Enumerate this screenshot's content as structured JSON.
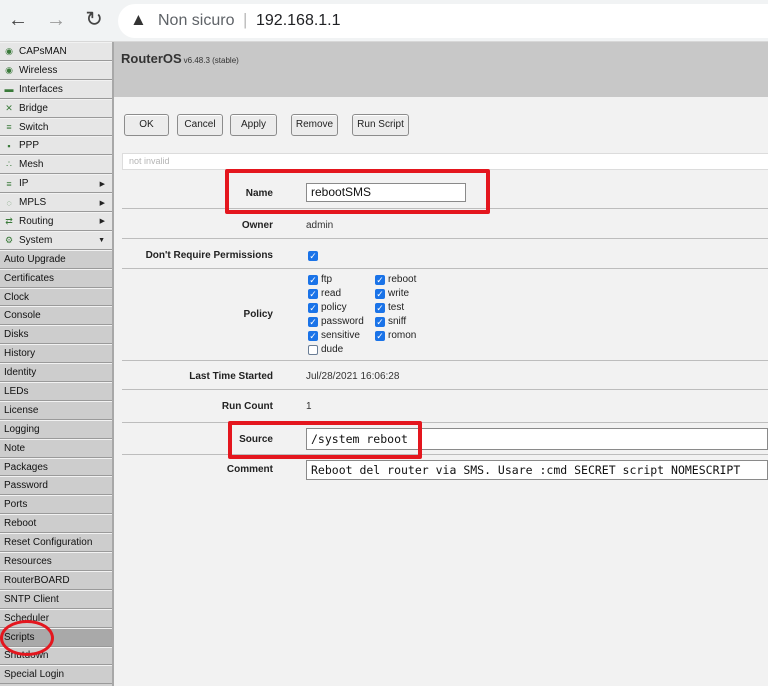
{
  "browser": {
    "back_glyph": "←",
    "forward_glyph": "→",
    "reload_glyph": "↻",
    "warning_glyph": "▲",
    "security_text": "Non sicuro",
    "separator": "|",
    "url": "192.168.1.1"
  },
  "sidebar": {
    "top_items": [
      {
        "label": "CAPsMAN",
        "icon": "capsman-icon",
        "glyph": "◉"
      },
      {
        "label": "Wireless",
        "icon": "wireless-icon",
        "glyph": "◉"
      },
      {
        "label": "Interfaces",
        "icon": "interfaces-icon",
        "glyph": "▬"
      },
      {
        "label": "Bridge",
        "icon": "bridge-icon",
        "glyph": "✕"
      },
      {
        "label": "Switch",
        "icon": "switch-icon",
        "glyph": "≡"
      },
      {
        "label": "PPP",
        "icon": "ppp-icon",
        "glyph": "▪"
      },
      {
        "label": "Mesh",
        "icon": "mesh-icon",
        "glyph": "∴"
      },
      {
        "label": "IP",
        "icon": "ip-icon",
        "glyph": "≡",
        "arrow": "▶"
      },
      {
        "label": "MPLS",
        "icon": "mpls-icon",
        "glyph": "◌",
        "arrow": "▶"
      },
      {
        "label": "Routing",
        "icon": "routing-icon",
        "glyph": "⇄",
        "arrow": "▶"
      },
      {
        "label": "System",
        "icon": "system-icon",
        "glyph": "⚙",
        "arrow": "▼"
      }
    ],
    "sub_items": [
      "Auto Upgrade",
      "Certificates",
      "Clock",
      "Console",
      "Disks",
      "History",
      "Identity",
      "LEDs",
      "License",
      "Logging",
      "Note",
      "Packages",
      "Password",
      "Ports",
      "Reboot",
      "Reset Configuration",
      "Resources",
      "RouterBOARD",
      "SNTP Client",
      "Scheduler",
      "Scripts",
      "Shutdown",
      "Special Login"
    ],
    "active_sub_item": "Scripts"
  },
  "header": {
    "brand": "RouterOS",
    "version": "v6.48.3 (stable)"
  },
  "toolbar": {
    "ok": "OK",
    "cancel": "Cancel",
    "apply": "Apply",
    "remove": "Remove",
    "run_script": "Run Script"
  },
  "status": "not invalid",
  "form": {
    "name_label": "Name",
    "name_value": "rebootSMS",
    "owner_label": "Owner",
    "owner_value": "admin",
    "dont_require_label": "Don't Require Permissions",
    "dont_require_checked": true,
    "policy_label": "Policy",
    "policies": [
      {
        "label": "ftp",
        "checked": true
      },
      {
        "label": "reboot",
        "checked": true
      },
      {
        "label": "read",
        "checked": true
      },
      {
        "label": "write",
        "checked": true
      },
      {
        "label": "policy",
        "checked": true
      },
      {
        "label": "test",
        "checked": true
      },
      {
        "label": "password",
        "checked": true
      },
      {
        "label": "sniff",
        "checked": true
      },
      {
        "label": "sensitive",
        "checked": true
      },
      {
        "label": "romon",
        "checked": true
      },
      {
        "label": "dude",
        "checked": false
      }
    ],
    "last_started_label": "Last Time Started",
    "last_started_value": "Jul/28/2021 16:06:28",
    "run_count_label": "Run Count",
    "run_count_value": "1",
    "source_label": "Source",
    "source_value": "/system reboot",
    "comment_label": "Comment",
    "comment_value": "Reboot del router via SMS. Usare :cmd SECRET script NOMESCRIPT"
  },
  "colors": {
    "highlight": "#e4161e",
    "checkbox": "#1a73e8",
    "sidebar_bg": "#d2d2d2",
    "main_bg": "#f2f2f2"
  }
}
